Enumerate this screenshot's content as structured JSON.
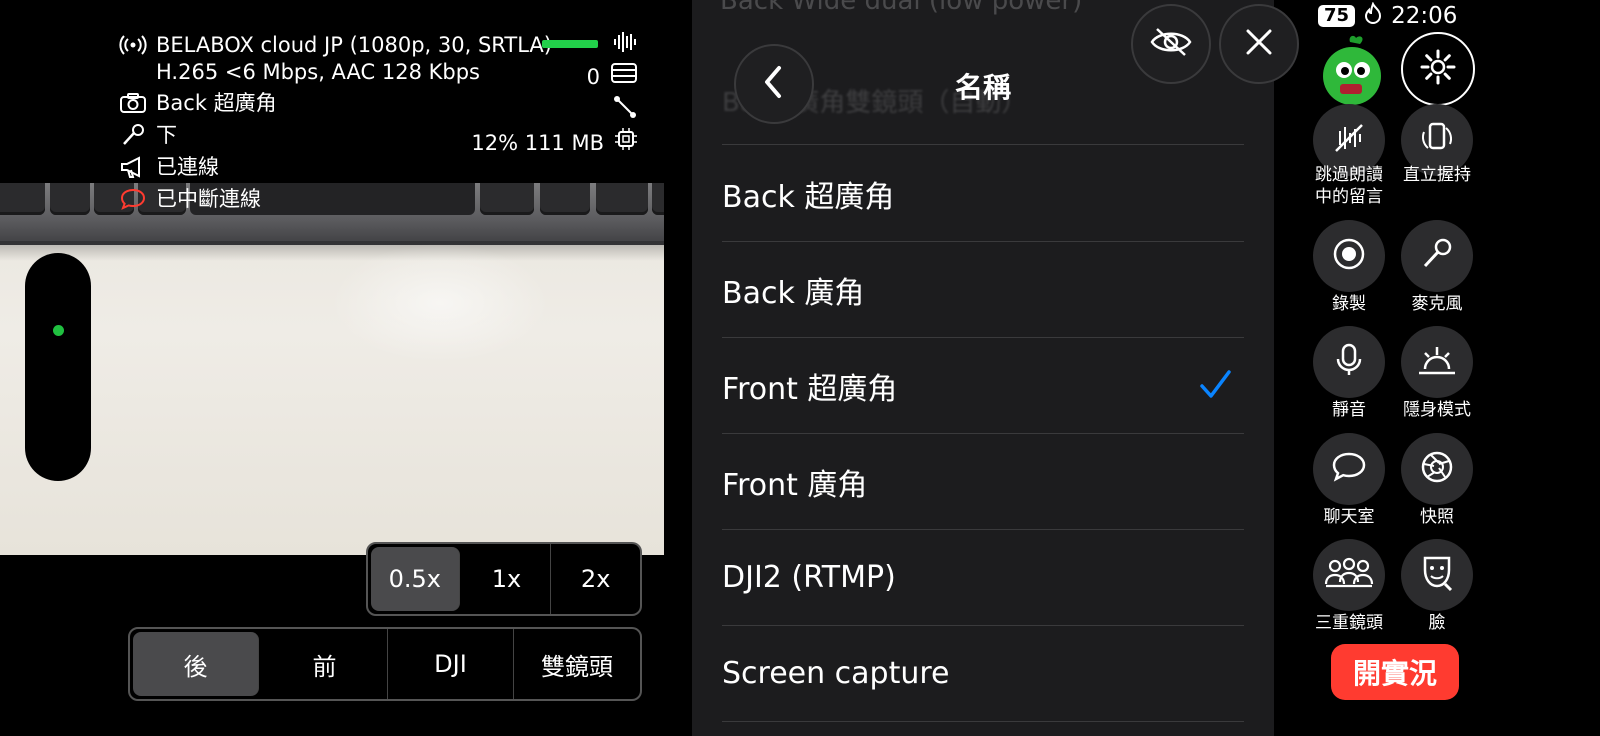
{
  "status": {
    "stream": "BELABOX cloud JP (1080p, 30, SRTLA)",
    "encoder": "H.265 <6 Mbps, AAC 128 Kbps",
    "camera": "Back 超廣角",
    "mic": "下",
    "announce": "已連線",
    "chat": "已中斷連線",
    "viewers": "0",
    "cpu": "12% 111 MB"
  },
  "zoom": {
    "options": [
      "0.5x",
      "1x",
      "2x"
    ],
    "selected": "0.5x"
  },
  "lens": {
    "options": [
      "後",
      "前",
      "DJI",
      "雙鏡頭"
    ],
    "selected": "後"
  },
  "panel": {
    "ghost_top": "Back Wide dual (low power)",
    "ghost_second": "Back 廣角雙鏡頭（自動）",
    "title": "名稱",
    "items": [
      "Back 超廣角",
      "Back 廣角",
      "Front 超廣角",
      "Front 廣角",
      "DJI2 (RTMP)",
      "Screen capture"
    ],
    "checked": "Front 超廣角"
  },
  "system": {
    "battery": "75",
    "time": "22:06"
  },
  "rail": {
    "buttons": [
      {
        "label": "跳過朗讀\n中的留言",
        "icon": "muted-chat-icon"
      },
      {
        "label": "直立握持",
        "icon": "portrait-icon"
      },
      {
        "label": "錄製",
        "icon": "record-icon"
      },
      {
        "label": "麥克風",
        "icon": "mic-icon"
      },
      {
        "label": "靜音",
        "icon": "mute-icon"
      },
      {
        "label": "隱身模式",
        "icon": "stealth-icon"
      },
      {
        "label": "聊天室",
        "icon": "chat-icon"
      },
      {
        "label": "快照",
        "icon": "snapshot-icon"
      },
      {
        "label": "三重鏡頭",
        "icon": "triple-camera-icon"
      },
      {
        "label": "臉",
        "icon": "face-icon"
      }
    ],
    "golive": "開實況"
  },
  "colors": {
    "accent": "#0a84ff",
    "live": "#ff3b30",
    "stream_ok": "#22d04a",
    "chat_error": "#ff3b30"
  }
}
